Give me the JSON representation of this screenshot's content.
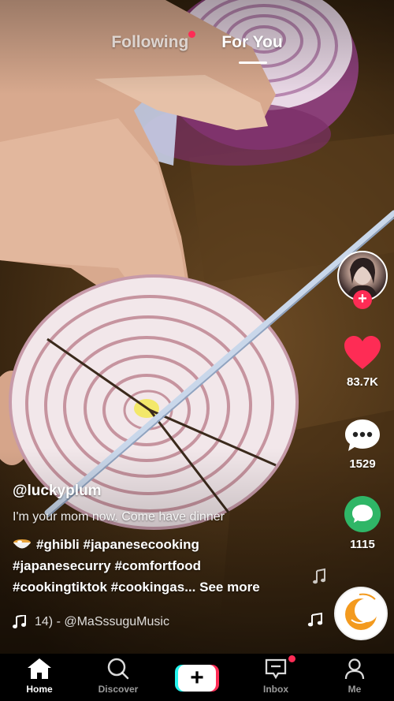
{
  "top_tabs": {
    "following": "Following",
    "for_you": "For You"
  },
  "creator": {
    "username": "@luckyplum"
  },
  "actions": {
    "likes": "83.7K",
    "comments": "1529",
    "shares": "1115"
  },
  "caption": {
    "text": "I'm your mom now. Come have dinner",
    "hashtags_line1": "#ghibli #japanesecooking",
    "hashtags_line2": "#japanesecurry #comfortfood",
    "hashtags_line3": "#cookingtiktok #cookingas...",
    "see_more": "See more"
  },
  "music": {
    "text": "14) - @MaSssuguMusic"
  },
  "nav": {
    "home": "Home",
    "discover": "Discover",
    "inbox": "Inbox",
    "me": "Me"
  },
  "colors": {
    "accent": "#fe2c55",
    "cyan": "#25f4ee",
    "like": "#fe2c55",
    "share": "#2fb667"
  },
  "icons": [
    "plus-icon",
    "heart-icon",
    "comment-icon",
    "share-icon",
    "music-note-icon",
    "home-icon",
    "search-icon",
    "create-icon",
    "inbox-icon",
    "profile-icon"
  ]
}
